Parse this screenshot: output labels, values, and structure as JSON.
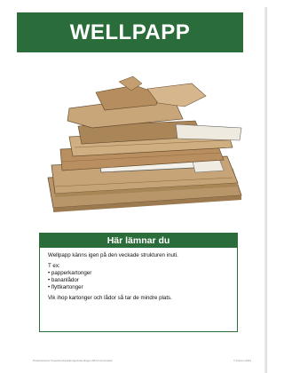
{
  "header": {
    "title": "WELLPAPP"
  },
  "panel": {
    "heading": "Här lämnar du",
    "intro": "Wellpapp känns igen på den veckade strukturen inuti.",
    "examples_label": "T ex:",
    "examples": [
      "• papperkartonger",
      "• bananlådor",
      "• flyttkartonger"
    ],
    "note": "Vik ihop kartonger och lådor så tar de mindre plats."
  },
  "footer": {
    "left": "Producerad av Svenska förpackningsinsamlingen AB för din bostad",
    "right": "© Fortum 2014"
  },
  "colors": {
    "brand_green": "#2b6d3a"
  },
  "photo": {
    "subject": "stack of flattened corrugated cardboard boxes"
  }
}
